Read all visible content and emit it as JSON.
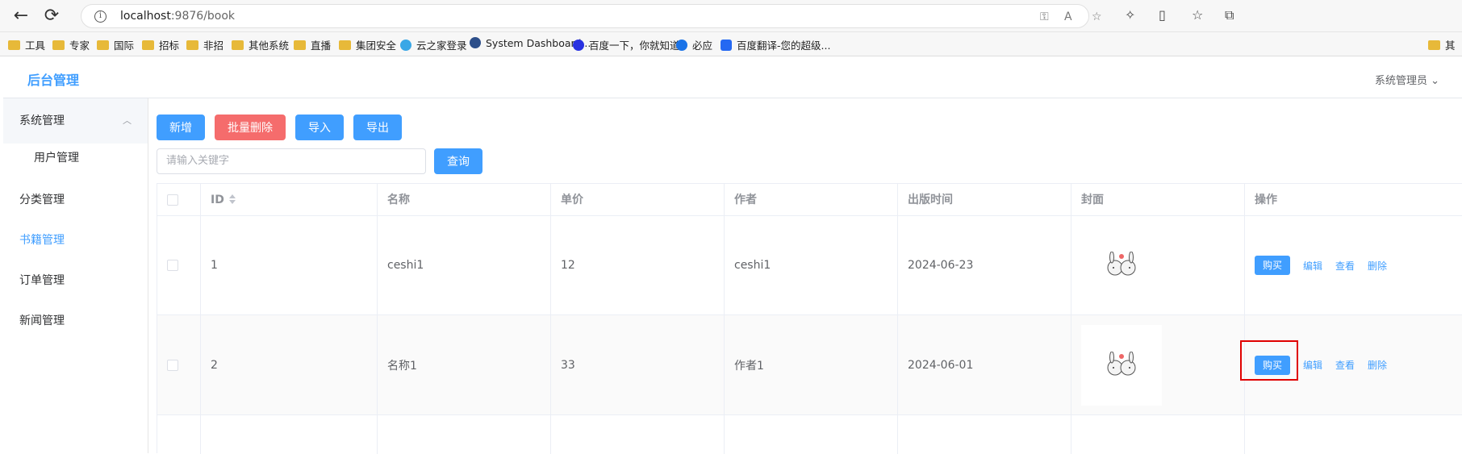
{
  "browser": {
    "url_host": "localhost",
    "url_port_path": ":9876/book",
    "bookmarks": [
      "工具",
      "专家",
      "国际",
      "招标",
      "非招",
      "其他系统",
      "直播",
      "集团安全",
      "云之家登录",
      "System Dashboard...",
      "百度一下，你就知道",
      "必应",
      "百度翻译-您的超级...",
      "其"
    ]
  },
  "app": {
    "title": "后台管理",
    "user": "系统管理员"
  },
  "sidebar": {
    "items": [
      {
        "label": "系统管理"
      },
      {
        "label": "用户管理"
      },
      {
        "label": "分类管理"
      },
      {
        "label": "书籍管理"
      },
      {
        "label": "订单管理"
      },
      {
        "label": "新闻管理"
      }
    ]
  },
  "toolbar": {
    "add": "新增",
    "batch_delete": "批量删除",
    "import": "导入",
    "export": "导出",
    "search_placeholder": "请输入关键字",
    "search": "查询"
  },
  "table": {
    "headers": [
      "ID",
      "名称",
      "单价",
      "作者",
      "出版时间",
      "封面",
      "操作"
    ],
    "rows": [
      {
        "id": "1",
        "name": "ceshi1",
        "price": "12",
        "author": "ceshi1",
        "date": "2024-06-23"
      },
      {
        "id": "2",
        "name": "名称1",
        "price": "33",
        "author": "作者1",
        "date": "2024-06-01"
      }
    ],
    "actions": {
      "buy": "购买",
      "edit": "编辑",
      "view": "查看",
      "delete": "删除"
    }
  },
  "colors": {
    "primary": "#409eff",
    "danger": "#f56c6c",
    "highlight": "#e00000"
  }
}
